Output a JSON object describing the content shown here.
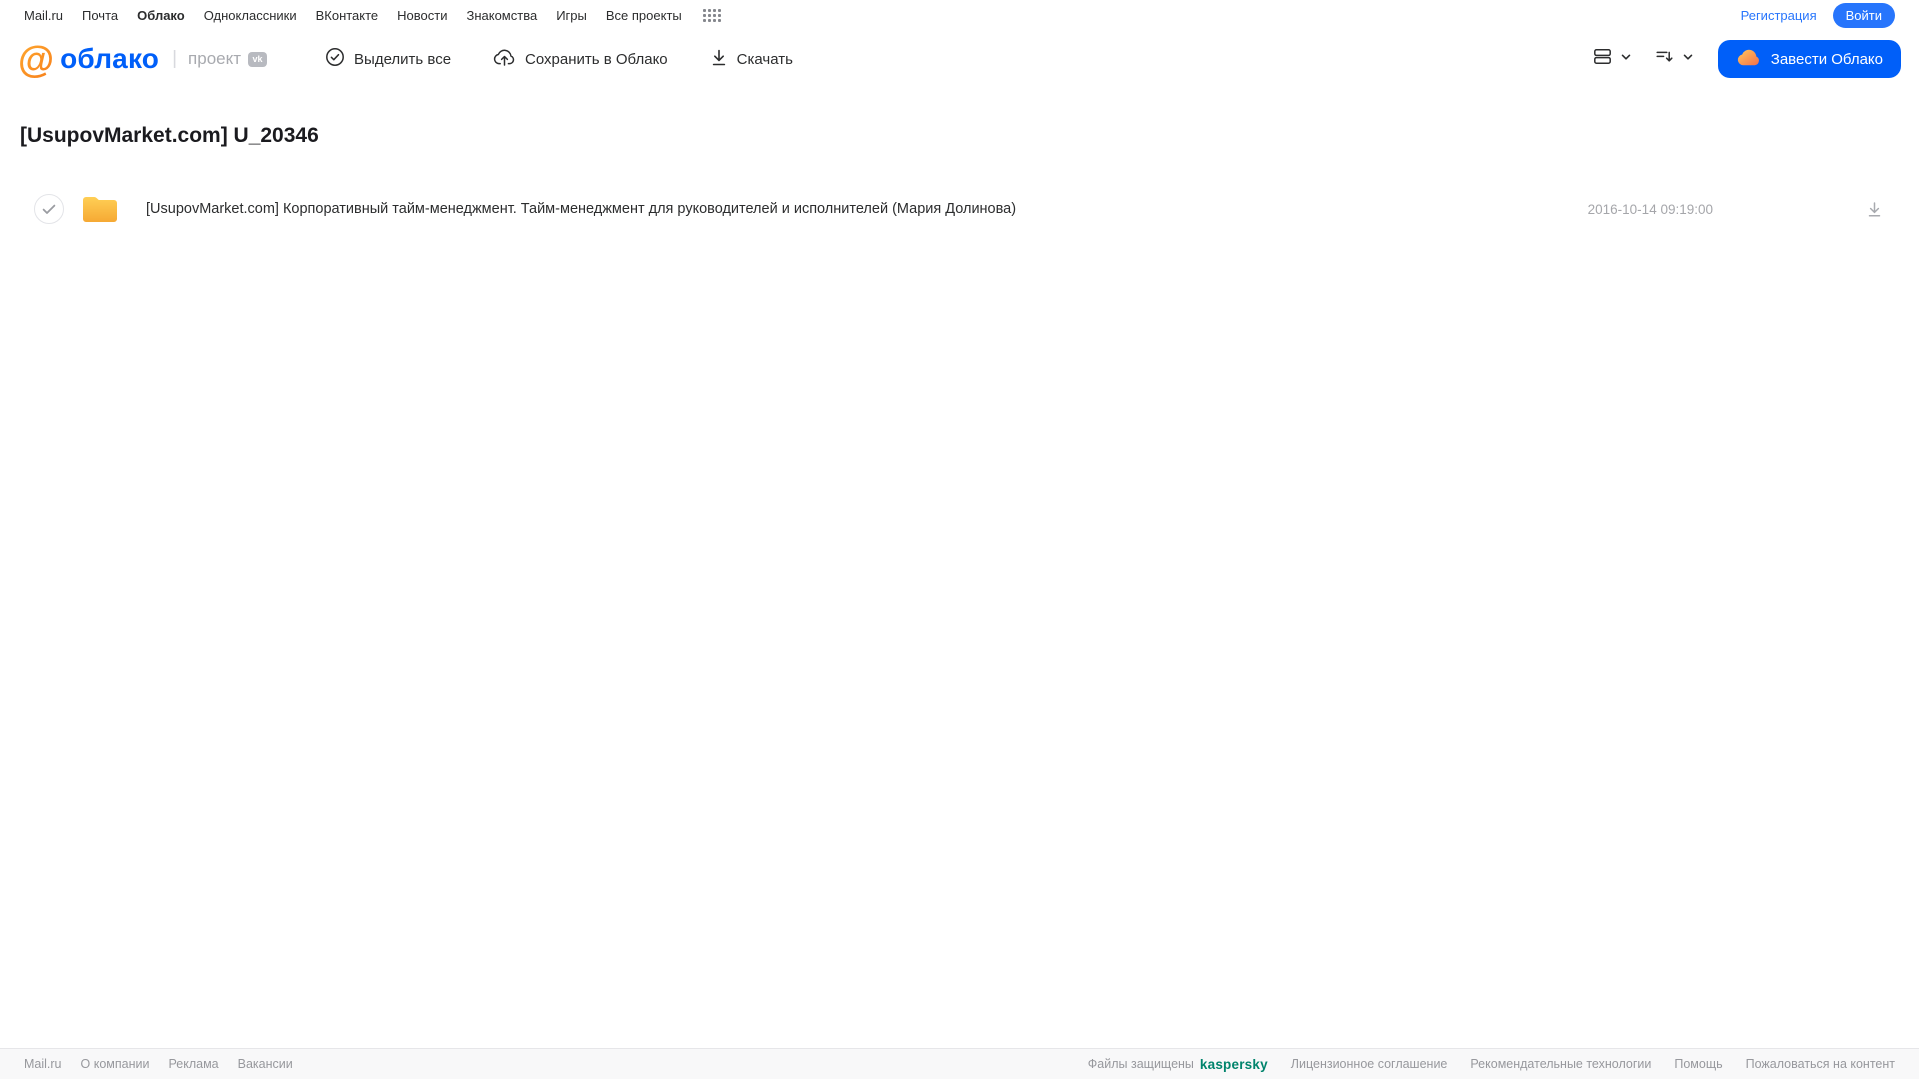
{
  "topnav": {
    "links": [
      "Mail.ru",
      "Почта",
      "Облако",
      "Одноклассники",
      "ВКонтакте",
      "Новости",
      "Знакомства",
      "Игры",
      "Все проекты"
    ],
    "active_link": "Облако",
    "registration_label": "Регистрация",
    "login_label": "Войти"
  },
  "header": {
    "logo_at": "@",
    "logo_word": "облако",
    "project_label": "проект",
    "vk_badge": "vk",
    "toolbar": {
      "select_all": "Выделить все",
      "save_to_cloud": "Сохранить в Облако",
      "download": "Скачать"
    },
    "get_cloud_button": "Завести Облако"
  },
  "page": {
    "title": "[UsupovMarket.com] U_20346"
  },
  "files": [
    {
      "type": "folder",
      "name": "[UsupovMarket.com] Корпоративный тайм-менеджмент. Тайм-менеджмент для руководителей и исполнителей (Мария Долинова)",
      "date": "2016-10-14 09:19:00"
    }
  ],
  "footer": {
    "left_links": [
      "Mail.ru",
      "О компании",
      "Реклама",
      "Вакансии"
    ],
    "protected_by": "Файлы защищены",
    "kaspersky_logo": "kaspersky",
    "right_links": [
      "Лицензионное соглашение",
      "Рекомендательные технологии",
      "Помощь",
      "Пожаловаться на контент"
    ]
  },
  "colors": {
    "accent_blue": "#005ff9",
    "brand_orange": "#f77f1b",
    "folder_top": "#ffcf55",
    "folder_bottom": "#f6a934",
    "kaspersky_green": "#00846c"
  }
}
